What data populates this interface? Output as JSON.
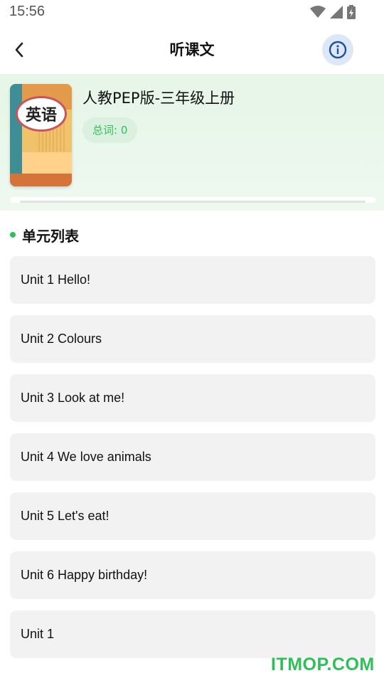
{
  "status_bar": {
    "time": "15:56"
  },
  "app_bar": {
    "title": "听课文"
  },
  "book": {
    "cover_label": "英语",
    "title": "人教PEP版-三年级上册",
    "word_count": "总词: 0",
    "progress": 0
  },
  "section": {
    "title": "单元列表"
  },
  "units": [
    {
      "label": "Unit 1 Hello!"
    },
    {
      "label": "Unit 2 Colours"
    },
    {
      "label": "Unit 3 Look at me!"
    },
    {
      "label": "Unit 4 We love animals"
    },
    {
      "label": "Unit 5 Let's eat!"
    },
    {
      "label": "Unit 6 Happy birthday!"
    },
    {
      "label": "Unit 1"
    }
  ],
  "watermark": "ITMOP.COM",
  "colors": {
    "accent": "#2fbf58",
    "info_bg": "#dde8f7",
    "info_icon": "#1f4fa0"
  }
}
